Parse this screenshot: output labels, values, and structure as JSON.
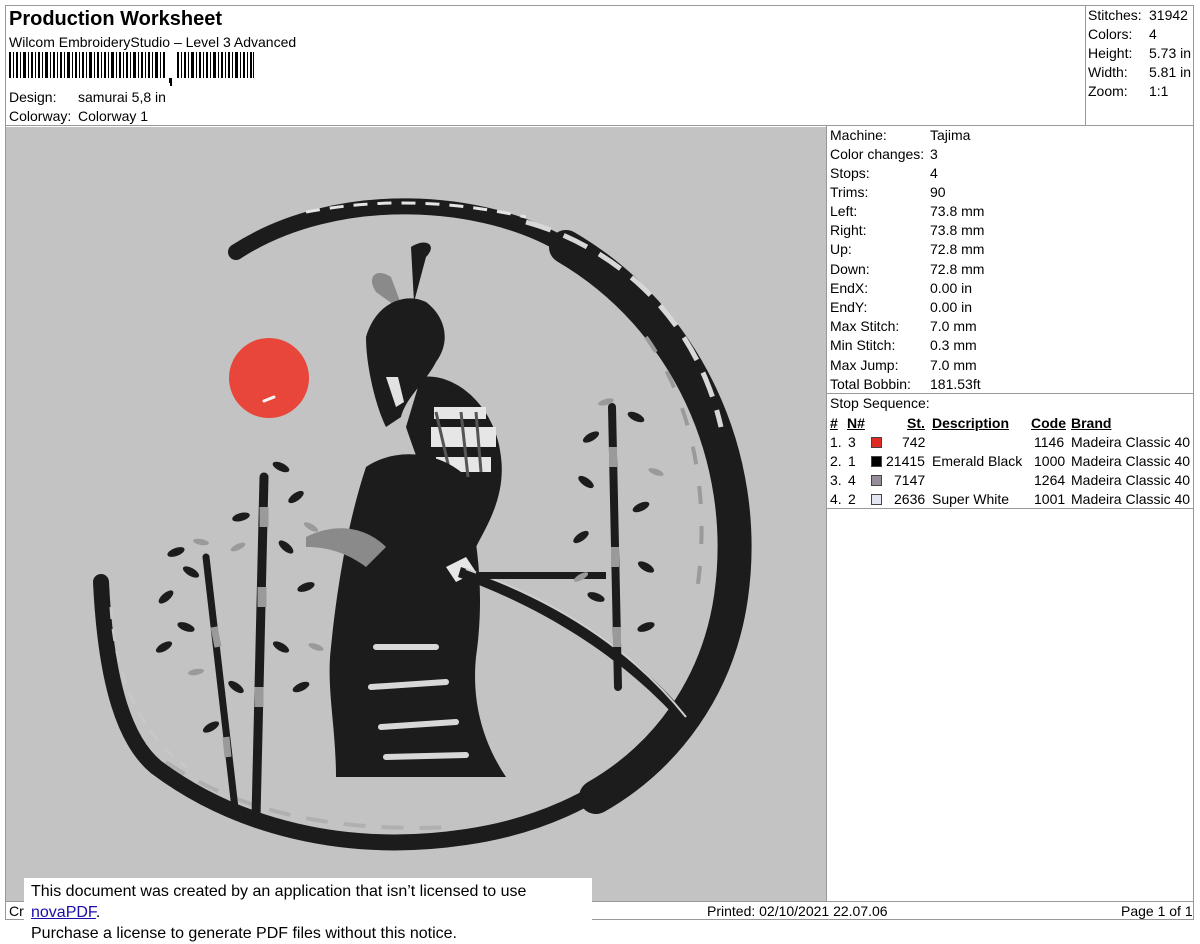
{
  "header": {
    "title": "Production Worksheet",
    "subtitle": "Wilcom EmbroideryStudio – Level 3 Advanced",
    "design_label": "Design:",
    "design_value": "samurai 5,8 in",
    "colorway_label": "Colorway:",
    "colorway_value": "Colorway 1"
  },
  "stats": [
    {
      "label": "Stitches:",
      "value": "31942"
    },
    {
      "label": "Colors:",
      "value": "4"
    },
    {
      "label": "Height:",
      "value": "5.73 in"
    },
    {
      "label": "Width:",
      "value": "5.81 in"
    },
    {
      "label": "Zoom:",
      "value": "1:1"
    }
  ],
  "specs": [
    {
      "label": "Machine:",
      "value": "Tajima"
    },
    {
      "label": "Color changes:",
      "value": "3"
    },
    {
      "label": "Stops:",
      "value": "4"
    },
    {
      "label": "Trims:",
      "value": "90"
    },
    {
      "label": "Left:",
      "value": "73.8 mm"
    },
    {
      "label": "Right:",
      "value": "73.8 mm"
    },
    {
      "label": "Up:",
      "value": "72.8 mm"
    },
    {
      "label": "Down:",
      "value": "72.8 mm"
    },
    {
      "label": "EndX:",
      "value": "0.00 in"
    },
    {
      "label": "EndY:",
      "value": "0.00 in"
    },
    {
      "label": "Max Stitch:",
      "value": "7.0 mm"
    },
    {
      "label": "Min Stitch:",
      "value": "0.3 mm"
    },
    {
      "label": "Max Jump:",
      "value": "7.0 mm"
    },
    {
      "label": "Total Bobbin:",
      "value": "181.53ft"
    }
  ],
  "stop_sequence": {
    "title": "Stop Sequence:",
    "headers": {
      "num": "#",
      "n": "N#",
      "st": "St.",
      "description": "Description",
      "code": "Code",
      "brand": "Brand"
    },
    "rows": [
      {
        "num": "1.",
        "n": "3",
        "color": "#e02b24",
        "st": "742",
        "description": "",
        "code": "1146",
        "brand": "Madeira Classic 40"
      },
      {
        "num": "2.",
        "n": "1",
        "color": "#000000",
        "st": "21415",
        "description": "Emerald Black",
        "code": "1000",
        "brand": "Madeira Classic 40"
      },
      {
        "num": "3.",
        "n": "4",
        "color": "#958e99",
        "st": "7147",
        "description": "",
        "code": "1264",
        "brand": "Madeira Classic 40"
      },
      {
        "num": "4.",
        "n": "2",
        "color": "#e2e6f2",
        "st": "2636",
        "description": "Super White",
        "code": "1001",
        "brand": "Madeira Classic 40"
      }
    ]
  },
  "notice": {
    "line1_prefix": "This document was created by an application that isn’t licensed to use ",
    "line1_link": "novaPDF",
    "line1_suffix": ".",
    "line2": "Purchase a license to generate PDF files without this notice."
  },
  "footer": {
    "left_fragment": "Cr",
    "printed": "Printed: 02/10/2021 22.07.06",
    "page": "Page 1 of 1"
  },
  "colors": {
    "background": "#c3c3c3",
    "sun": "#e8463b",
    "thread_black": "#1c1c1c",
    "thread_grey": "#8f8f8f",
    "thread_white": "#e6e6e6"
  }
}
